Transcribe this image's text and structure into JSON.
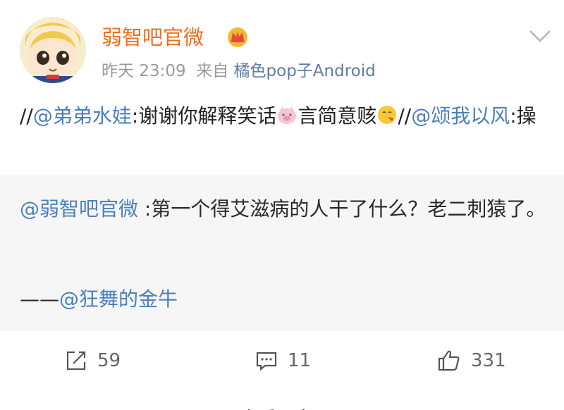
{
  "post": {
    "username": "弱智吧官微",
    "time": "昨天 23:09",
    "from_label": "来自",
    "source": "橘色pop子Android",
    "body": {
      "seg1": "//",
      "mention1": "@弟弟水娃",
      "seg2": ":谢谢你解释笑话",
      "seg3": "言简意赅",
      "seg4": "//",
      "mention2": "@颂我以风",
      "seg5": ":操"
    }
  },
  "retweet": {
    "mention": "@弱智吧官微",
    "text": " :第一个得艾滋病的人干了什么？老二刺猿了。",
    "credit_prefix": "——",
    "credit_mention": "@狂舞的金牛"
  },
  "actions": {
    "repost_count": "59",
    "comment_count": "11",
    "like_count": "331"
  },
  "footer": {
    "more_label": "查看更多"
  },
  "colors": {
    "username": "#f26e1c",
    "link": "#4a7fbe",
    "meta": "#9a9a9a",
    "retweet_bg": "#f6f6f6"
  }
}
